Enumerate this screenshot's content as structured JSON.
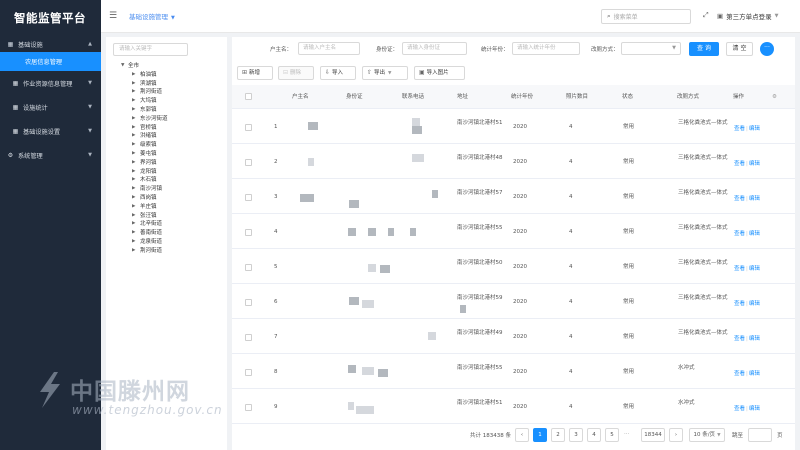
{
  "app": {
    "title": "智能监管平台"
  },
  "sidebar": {
    "groups": [
      {
        "label": "基础设施",
        "icon": "grid-icon"
      },
      {
        "label": "作业资源信息管理",
        "icon": "grid-icon"
      },
      {
        "label": "设施统计",
        "icon": "grid-icon"
      },
      {
        "label": "基础设施设置",
        "icon": "grid-icon"
      },
      {
        "label": "系统管理",
        "icon": "gear-icon"
      }
    ],
    "active_item": "农居信息管理"
  },
  "header": {
    "breadcrumb": "基础设施管理",
    "search_placeholder": "搜索菜单",
    "user": "第三方单点登录"
  },
  "tree": {
    "search_placeholder": "请输入关键字",
    "root": "全市",
    "items": [
      "柏油镇",
      "滨湖镇",
      "荆河街道",
      "大坞镇",
      "东郭镇",
      "东沙河街道",
      "官桥镇",
      "洪绪镇",
      "级索镇",
      "姜屯镇",
      "界河镇",
      "龙阳镇",
      "木石镇",
      "南沙河镇",
      "西岗镇",
      "羊庄镇",
      "张汪镇",
      "北辛街道",
      "善南街道",
      "龙泉街道",
      "荆河街道"
    ]
  },
  "filters": {
    "owner_label": "户主名：",
    "owner_placeholder": "请输入户主名",
    "id_label": "身份证：",
    "id_placeholder": "请输入身份证",
    "year_label": "统计年份：",
    "year_placeholder": "请输入统计年份",
    "method_label": "改厕方式：",
    "method_placeholder": "",
    "query": "查 询",
    "clear": "清 空",
    "more": "···"
  },
  "toolbar": {
    "add": "新增",
    "delete": "删除",
    "import": "导入",
    "export": "导出",
    "import_image": "导入图片"
  },
  "table": {
    "headers": [
      "户主名",
      "身份证",
      "联系电话",
      "地址",
      "统计年份",
      "照片数目",
      "状态",
      "改厕方式",
      "操作"
    ],
    "rows": [
      {
        "no": "1",
        "address": "南沙河镇北港村51",
        "year": "2020",
        "photos": "4",
        "status": "常用",
        "method": "三格化粪池式—体式",
        "view": "查看",
        "edit": "编辑"
      },
      {
        "no": "2",
        "address": "南沙河镇北港村48",
        "year": "2020",
        "photos": "4",
        "status": "常用",
        "method": "三格化粪池式—体式",
        "view": "查看",
        "edit": "编辑"
      },
      {
        "no": "3",
        "address": "南沙河镇北港村57",
        "year": "2020",
        "photos": "4",
        "status": "常用",
        "method": "三格化粪池式—体式",
        "view": "查看",
        "edit": "编辑"
      },
      {
        "no": "4",
        "address": "南沙河镇北港村55",
        "year": "2020",
        "photos": "4",
        "status": "常用",
        "method": "三格化粪池式—体式",
        "view": "查看",
        "edit": "编辑"
      },
      {
        "no": "5",
        "address": "南沙河镇北港村50",
        "year": "2020",
        "photos": "4",
        "status": "常用",
        "method": "三格化粪池式—体式",
        "view": "查看",
        "edit": "编辑"
      },
      {
        "no": "6",
        "address": "南沙河镇北港村59",
        "year": "2020",
        "photos": "4",
        "status": "常用",
        "method": "三格化粪池式—体式",
        "view": "查看",
        "edit": "编辑"
      },
      {
        "no": "7",
        "address": "南沙河镇北港村49",
        "year": "2020",
        "photos": "4",
        "status": "常用",
        "method": "三格化粪池式—体式",
        "view": "查看",
        "edit": "编辑"
      },
      {
        "no": "8",
        "address": "南沙河镇北港村55",
        "year": "2020",
        "photos": "4",
        "status": "常用",
        "method": "水冲式",
        "view": "查看",
        "edit": "编辑"
      },
      {
        "no": "9",
        "address": "南沙河镇北港村51",
        "year": "2020",
        "photos": "4",
        "status": "常用",
        "method": "水冲式",
        "view": "查看",
        "edit": "编辑"
      }
    ]
  },
  "pagination": {
    "total": "共计 183438 条",
    "pages": [
      "1",
      "2",
      "3",
      "4",
      "5"
    ],
    "ellipsis": "···",
    "last": "18344",
    "page_size": "10 条/页",
    "jump_label": "跳至",
    "page_unit": "页"
  },
  "watermark": {
    "line1": "中国滕州网",
    "line2": "www.tengzhou.gov.cn"
  },
  "colors": {
    "sidebar": "#1f2a3a",
    "accent": "#1890ff"
  }
}
